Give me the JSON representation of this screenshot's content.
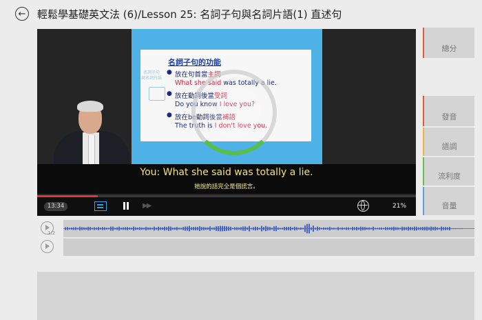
{
  "header": {
    "back_icon": "back-arrow-icon",
    "title": "輕鬆學基礎英文法 (6)/Lesson 25: 名詞子句與名詞片語(1) 直述句"
  },
  "slide": {
    "heading": "名詞子句的功能",
    "side_label": "名詞子句 與名詞片語",
    "side_icon": "presentation-board-icon",
    "items": [
      {
        "label": "放在句首當",
        "role": "主詞",
        "example_pre": "What she said ",
        "example_rest": "was totally a lie."
      },
      {
        "label": "放在動詞後當",
        "role": "受詞",
        "example_pre": "Do you know ",
        "example_rest": "I love you?"
      },
      {
        "label": "放在be動詞後當",
        "role": "補語",
        "example_pre": "The truth is ",
        "example_rest": "I don't love you."
      }
    ]
  },
  "player": {
    "subtitle_en": "You: What she said was totally a lie.",
    "subtitle_zh": "她說的話完全是個謊言。",
    "current_time": "13:34",
    "progress": 0.16,
    "speed": "21%",
    "subtitle_toggle_icon": "subtitle-icon",
    "pause_icon": "pause-icon",
    "forward_icon": "fast-forward-icon",
    "language_icon": "globe-icon",
    "loading_icon": "loading-spinner-icon",
    "accent_color": "#39a0e5",
    "subtitle_color": "#f3e27a"
  },
  "side_panel": {
    "buttons": [
      {
        "label": "總分",
        "accent": "#e05a3a"
      },
      {
        "label": "發音",
        "accent": "#e05a3a"
      },
      {
        "label": "語調",
        "accent": "#f2b13a"
      },
      {
        "label": "流利度",
        "accent": "#65c04c"
      },
      {
        "label": "音量",
        "accent": "#5aa0e0"
      }
    ]
  },
  "recorder": {
    "play_icon": "play-icon",
    "page_indicator": "1/2"
  }
}
